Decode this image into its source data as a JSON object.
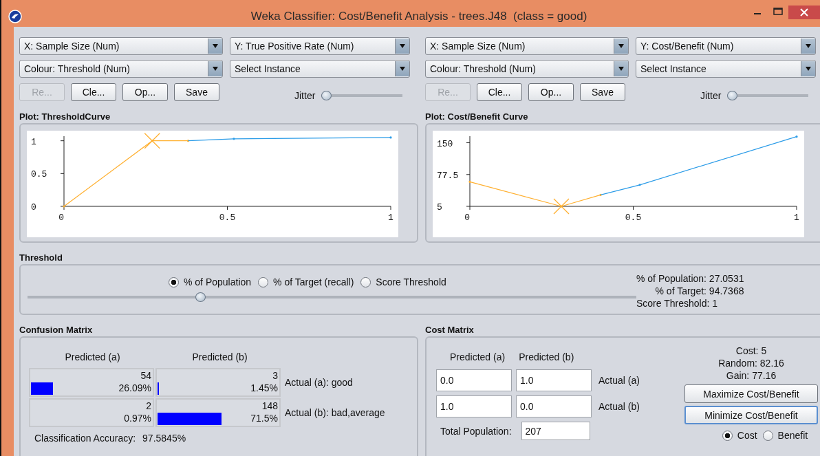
{
  "window": {
    "title": "Weka Classifier: Cost/Benefit Analysis - trees.J48  (class = good)"
  },
  "plots": [
    {
      "x_axis": "X: Sample Size (Num)",
      "y_axis": "Y: True Positive Rate (Num)",
      "colour": "Colour: Threshold (Num)",
      "instance": "Select Instance",
      "buttons": [
        {
          "label": "Re...",
          "disabled": true
        },
        {
          "label": "Cle...",
          "disabled": false
        },
        {
          "label": "Op...",
          "disabled": false
        },
        {
          "label": "Save",
          "disabled": false
        }
      ],
      "jitter": {
        "label": "Jitter",
        "level": 0
      },
      "title": "Plot: ThresholdCurve",
      "chart_data": {
        "type": "line",
        "x": [
          0,
          0.27,
          0.38,
          0.52,
          1
        ],
        "series": [
          {
            "color": "#ffb030",
            "values": [
              0,
              1,
              1,
              null,
              null
            ]
          },
          {
            "color": "#2b9ce8",
            "values": [
              null,
              null,
              1,
              1.03,
              1.05
            ]
          }
        ],
        "xlim": [
          0,
          1
        ],
        "ylim": [
          0,
          1.07
        ],
        "xticks": [
          0,
          0.5,
          1
        ],
        "yticks": [
          0,
          0.5,
          1
        ]
      }
    },
    {
      "x_axis": "X: Sample Size (Num)",
      "y_axis": "Y: Cost/Benefit (Num)",
      "colour": "Colour: Threshold (Num)",
      "instance": "Select Instance",
      "buttons": [
        {
          "label": "Re...",
          "disabled": true
        },
        {
          "label": "Cle...",
          "disabled": false
        },
        {
          "label": "Op...",
          "disabled": false
        },
        {
          "label": "Save",
          "disabled": false
        }
      ],
      "jitter": {
        "label": "Jitter",
        "level": 0
      },
      "title": "Plot: Cost/Benefit Curve",
      "chart_data": {
        "type": "line",
        "x": [
          0,
          0.28,
          0.4,
          0.52,
          1
        ],
        "series": [
          {
            "color": "#ffb030",
            "values": [
              61,
              5,
              31,
              null,
              null
            ]
          },
          {
            "color": "#2b9ce8",
            "values": [
              null,
              null,
              31,
              54,
              164
            ]
          }
        ],
        "xlim": [
          0,
          1
        ],
        "ylim": [
          5,
          165
        ],
        "xticks": [
          0,
          0.5,
          1
        ],
        "yticks": [
          5,
          77.5,
          150
        ]
      }
    }
  ],
  "threshold": {
    "title": "Threshold",
    "options": [
      {
        "label": "% of Population",
        "selected": true
      },
      {
        "label": "% of Target (recall)",
        "selected": false
      },
      {
        "label": "Score Threshold",
        "selected": false
      }
    ],
    "slider": {
      "level": 0.28
    },
    "stats": [
      "% of Population: 27.0531",
      "% of Target: 94.7368",
      "Score Threshold: 1"
    ]
  },
  "confusion_matrix": {
    "title": "Confusion Matrix",
    "columns": [
      "Predicted (a)",
      "Predicted (b)"
    ],
    "rows": [
      {
        "label": "Actual (a): good",
        "cells": [
          {
            "count": "54",
            "percent": "26.09%",
            "level": 0.18
          },
          {
            "count": "3",
            "percent": "1.45%",
            "level": 0.01
          }
        ]
      },
      {
        "label": "Actual (b): bad,average",
        "cells": [
          {
            "count": "2",
            "percent": "0.97%",
            "level": 0
          },
          {
            "count": "148",
            "percent": "71.5%",
            "level": 0.52
          }
        ]
      }
    ],
    "accuracy_label": "Classification Accuracy:",
    "accuracy": "97.5845%"
  },
  "cost_matrix": {
    "title": "Cost Matrix",
    "columns": [
      "Predicted (a)",
      "Predicted (b)"
    ],
    "rows": [
      {
        "label": "Actual (a)",
        "values": [
          "0.0",
          "1.0"
        ]
      },
      {
        "label": "Actual (b)",
        "values": [
          "1.0",
          "0.0"
        ]
      }
    ],
    "total_label": "Total Population:",
    "total": "207",
    "stats": [
      "Cost: 5",
      "Random: 82.16",
      "Gain: 77.16"
    ],
    "buttons": [
      {
        "label": "Maximize Cost/Benefit",
        "focused": false
      },
      {
        "label": "Minimize Cost/Benefit",
        "focused": true
      }
    ],
    "options": [
      {
        "label": "Cost",
        "selected": true
      },
      {
        "label": "Benefit",
        "selected": false
      }
    ]
  }
}
